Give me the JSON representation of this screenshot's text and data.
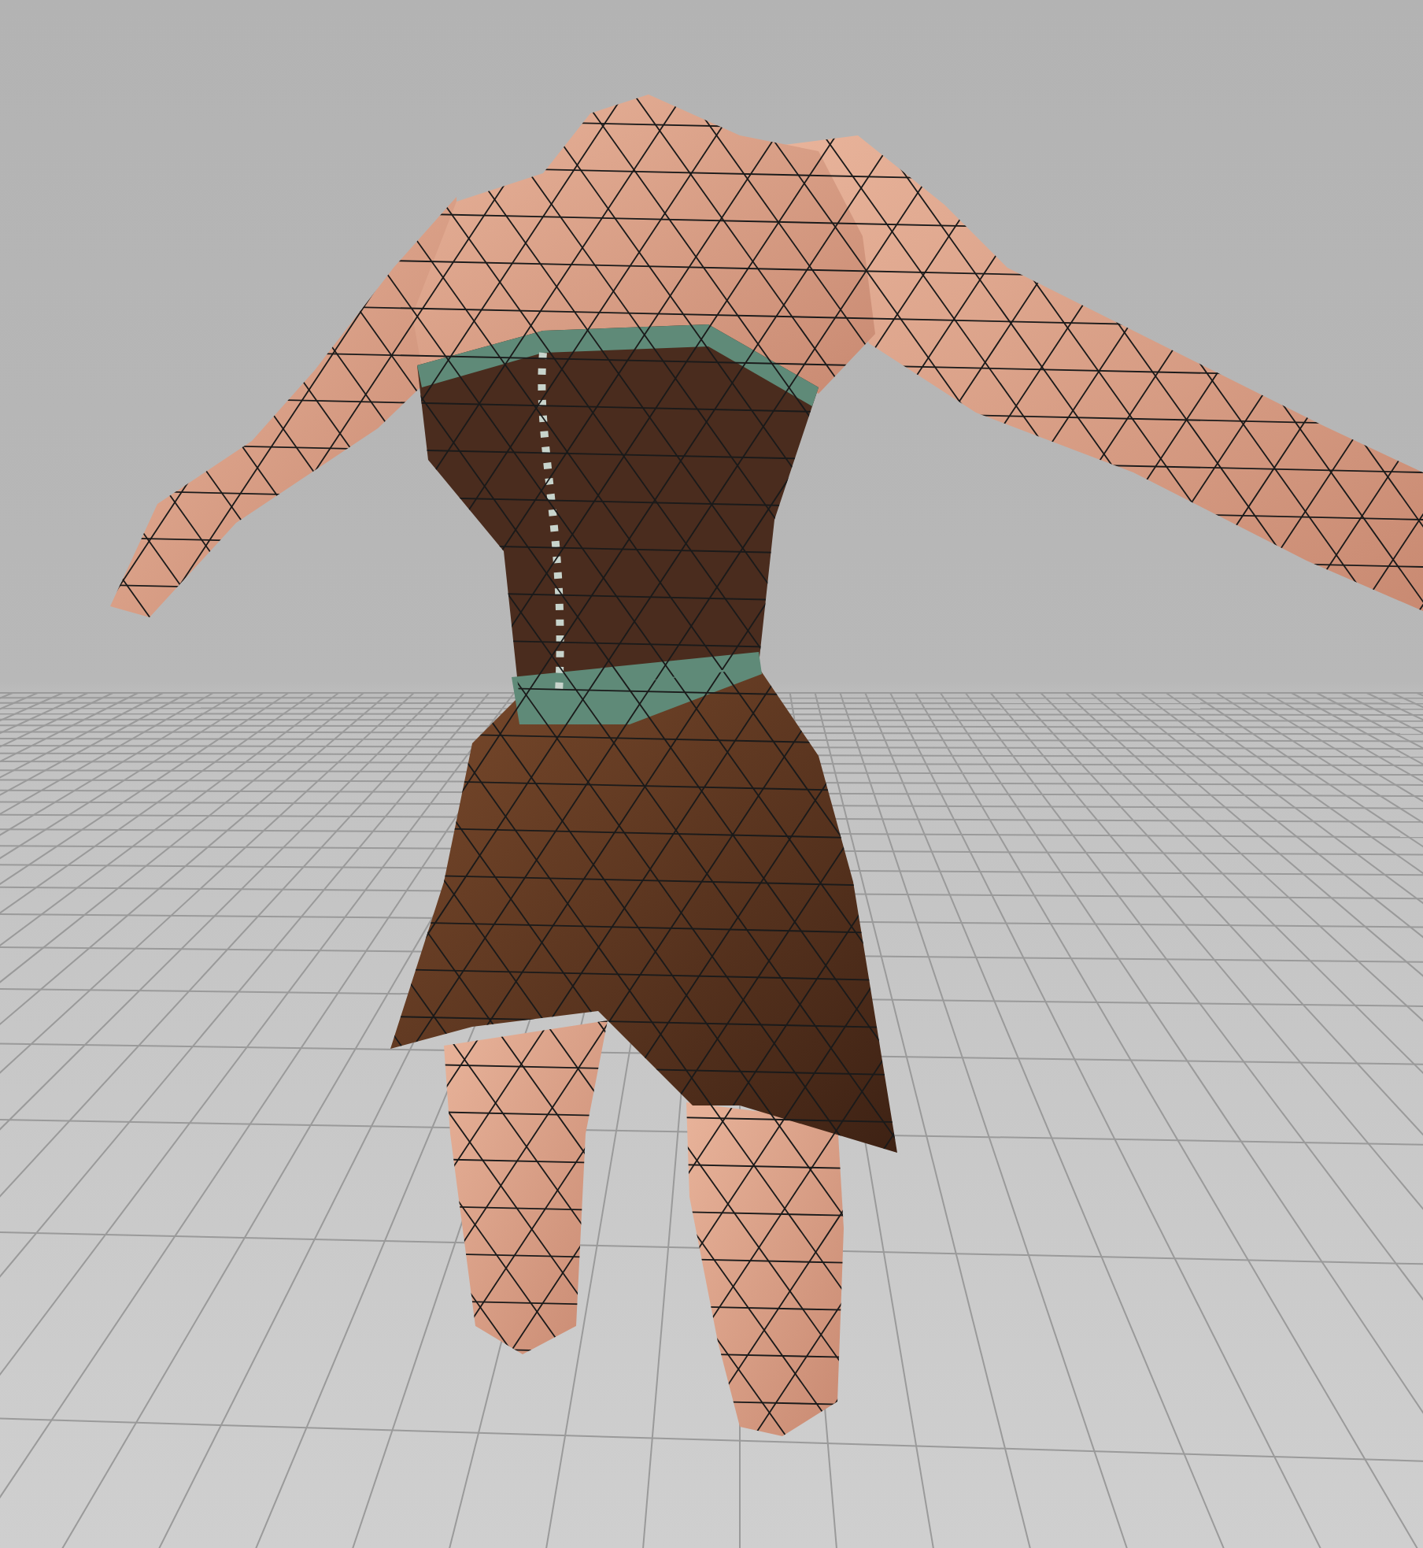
{
  "viewport": {
    "grid_visible": true,
    "model": {
      "kind": "mesh",
      "wireframe": true
    }
  }
}
